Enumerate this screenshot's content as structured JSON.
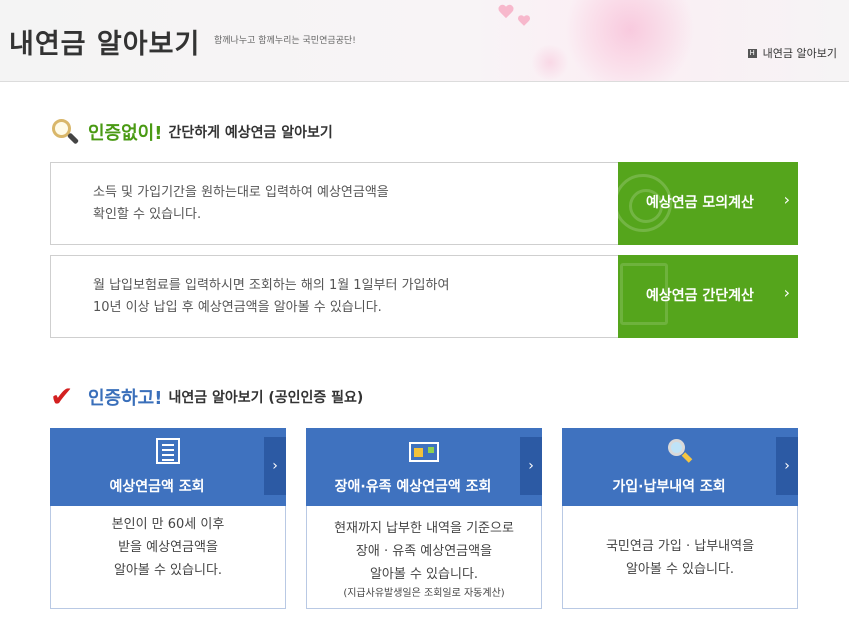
{
  "header": {
    "title": "내연금 알아보기",
    "slogan": "함께나누고 함께누리는 국민연금공단!",
    "breadcrumb": "내연금 알아보기",
    "home_icon_glyph": "H"
  },
  "section_no_auth": {
    "emphasis": "인증없이!",
    "title": "간단하게 예상연금 알아보기",
    "icon": "magnifier-icon",
    "rows": [
      {
        "desc_line1": "소득 및 가입기간을 원하는대로 입력하여 예상연금액을",
        "desc_line2": "확인할 수 있습니다.",
        "button_label": "예상연금 모의계산",
        "bg_icon": "target-icon"
      },
      {
        "desc_line1": "월 납입보험료를 입력하시면 조회하는 해의 1월 1일부터 가입하여",
        "desc_line2": "10년 이상 납입 후 예상연금액을 알아볼 수 있습니다.",
        "button_label": "예상연금 간단계산",
        "bg_icon": "calculator-icon"
      }
    ]
  },
  "section_auth": {
    "emphasis": "인증하고!",
    "title": "내연금 알아보기 (공인인증 필요)",
    "icon": "checkmark-icon",
    "cards": [
      {
        "title": "예상연금액 조회",
        "icon": "document-list-icon",
        "lines": [
          "본인이 만 60세 이후",
          "받을 예상연금액을",
          "알아볼 수 있습니다."
        ],
        "note": ""
      },
      {
        "title": "장애·유족 예상연금액 조회",
        "icon": "id-card-icon",
        "lines": [
          "현재까지 납부한 내역을 기준으로",
          "장애 · 유족 예상연금액을",
          "알아볼 수 있습니다."
        ],
        "note": "(지급사유발생일은 조회일로 자동계산)"
      },
      {
        "title": "가입·납부내역 조회",
        "icon": "magnifier-icon",
        "lines": [
          "국민연금 가입 · 납부내역을",
          "알아볼 수 있습니다."
        ],
        "note": ""
      }
    ]
  },
  "arrow_glyph": "›",
  "check_glyph": "✔",
  "colors": {
    "green": "#55a51c",
    "green_text": "#4a9a14",
    "blue": "#3f72bf",
    "blue_dark": "#2c5aa4",
    "check_red": "#d32020"
  }
}
